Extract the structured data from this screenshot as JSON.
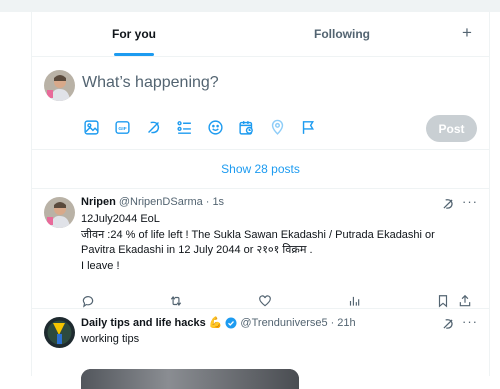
{
  "tabs": {
    "for_you": "For you",
    "following": "Following",
    "add": "+"
  },
  "composer": {
    "placeholder": "What’s happening?",
    "post_label": "Post",
    "tools": [
      "media-icon",
      "gif-icon",
      "grok-icon",
      "poll-icon",
      "emoji-icon",
      "schedule-icon",
      "location-icon",
      "flag-icon"
    ]
  },
  "show_posts": "Show 28 posts",
  "tweets": [
    {
      "name": "Nripen",
      "handle": "@NripenDSarma",
      "dot": "·",
      "time": "1s",
      "lines": [
        "12July2044 EoL",
        "जीवन :24 % of life left ! The Sukla Sawan Ekadashi / Putrada Ekadashi or",
        "Pavitra Ekadashi in 12 July 2044 or २१०१ विक्रम .",
        "I leave !"
      ],
      "more": "···"
    },
    {
      "name": "Daily tips and life hacks",
      "emoji": "💪",
      "handle": "@Trenduniverse5",
      "dot": "·",
      "time": "21h",
      "lines": [
        "working tips"
      ],
      "more": "···"
    }
  ],
  "colors": {
    "accent": "#1d9bf0",
    "text": "#0f1419",
    "muted": "#536471",
    "post_disabled": "#c9cfd3",
    "border": "#eff3f4"
  }
}
